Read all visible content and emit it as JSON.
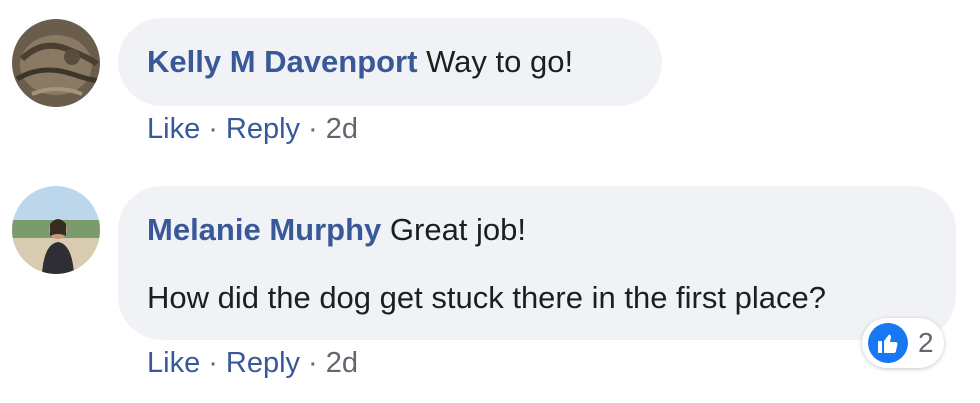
{
  "comments": [
    {
      "author": "Kelly M Davenport",
      "lines": [
        "Way to go!"
      ],
      "actions": {
        "like": "Like",
        "reply": "Reply",
        "time": "2d"
      }
    },
    {
      "author": "Melanie Murphy",
      "lines": [
        "Great job!",
        "How did the dog get stuck there in the first place?"
      ],
      "actions": {
        "like": "Like",
        "reply": "Reply",
        "time": "2d"
      },
      "reactions": {
        "icon": "thumbs-up-icon",
        "count": "2"
      }
    }
  ],
  "separator": "·",
  "colors": {
    "name": "#385898",
    "bubble": "#f0f2f5",
    "like": "#1877f2"
  }
}
